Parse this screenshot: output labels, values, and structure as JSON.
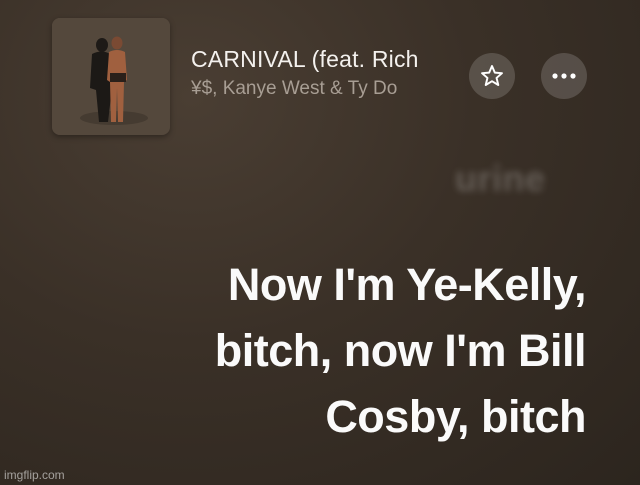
{
  "now_playing": {
    "title": "CARNIVAL (feat. Rich",
    "artist": "¥$, Kanye West & Ty Do",
    "artwork_icon": "album-art"
  },
  "controls": {
    "favorite_icon": "star-icon",
    "more_icon": "ellipsis-icon"
  },
  "lyrics": {
    "previous_line": "urine",
    "current_line_1": "Now I'm Ye-Kelly,",
    "current_line_2": "bitch, now I'm Bill",
    "current_line_3": "Cosby, bitch"
  },
  "watermark": "imgflip.com"
}
